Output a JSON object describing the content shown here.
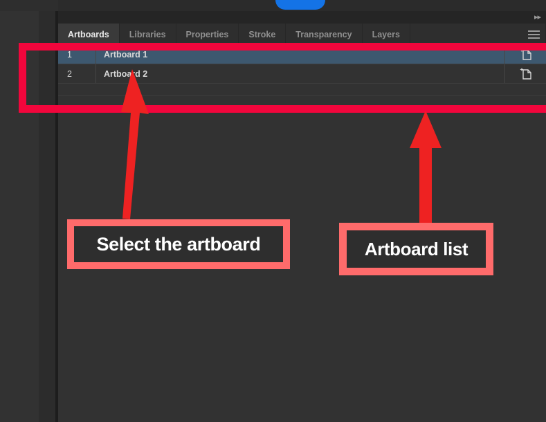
{
  "app": {
    "theme_bg": "#323232",
    "accent_blue": "#1473e6",
    "selection_blue": "#3d586f",
    "annotation_red": "#f2063c",
    "annotation_coral": "#ff6b6b"
  },
  "topbar": {
    "blue_button_label": "",
    "expand_icon": "chevron-double-right-icon",
    "expand_glyph": "▸▸"
  },
  "tabs": [
    {
      "label": "Artboards",
      "active": true
    },
    {
      "label": "Libraries",
      "active": false
    },
    {
      "label": "Properties",
      "active": false
    },
    {
      "label": "Stroke",
      "active": false
    },
    {
      "label": "Transparency",
      "active": false
    },
    {
      "label": "Layers",
      "active": false
    }
  ],
  "panel_menu": {
    "icon": "hamburger-menu-icon"
  },
  "artboard_list": {
    "rows": [
      {
        "number": "1",
        "name": "Artboard 1",
        "selected": true,
        "icon": "artboard-icon"
      },
      {
        "number": "2",
        "name": "Artboard 2",
        "selected": false,
        "icon": "artboard-icon"
      }
    ]
  },
  "annotations": {
    "highlight_rect": {
      "target": "artboard-list-region"
    },
    "callouts": [
      {
        "id": "select-the-artboard",
        "text": "Select the artboard",
        "arrow": "up"
      },
      {
        "id": "artboard-list",
        "text": "Artboard list",
        "arrow": "up"
      }
    ]
  }
}
